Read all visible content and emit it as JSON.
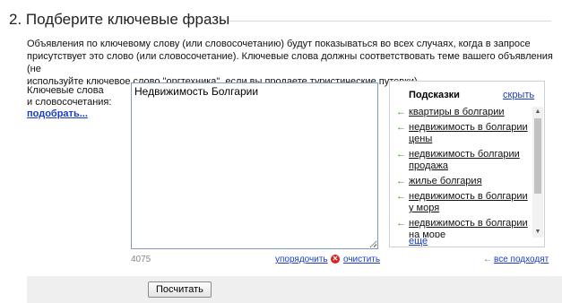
{
  "section": {
    "title": "2. Подберите ключевые фразы"
  },
  "description": {
    "line1": "Объявления по ключевому слову (или словосочетанию) будут показываться во всех случаях, когда в запросе",
    "line2": "присутствует это слово (или словосочетание). Ключевые слова должны соответствовать теме вашего объявления (не",
    "line3": "используйте ключевое слово \"оргтехника\", если вы продаете туристические путевки)."
  },
  "keywords": {
    "label_line1": "Ключевые слова",
    "label_line2": "и словосочетания:",
    "pick_link": "подобрать...",
    "value": "Недвижимость Болгарии",
    "char_count": "4075",
    "sort_link": "упорядочить",
    "clear_link": "очистить"
  },
  "hints": {
    "title": "Подсказки",
    "hide_link": "скрыть",
    "items": [
      {
        "line1": "квартиры в болгарии",
        "line2": ""
      },
      {
        "line1": "недвижимость в болгарии",
        "line2": "цены"
      },
      {
        "line1": "недвижимость болгарии",
        "line2": "продажа"
      },
      {
        "line1": "жилье болгария",
        "line2": ""
      },
      {
        "line1": "недвижимость в болгарии",
        "line2": "у моря"
      },
      {
        "line1": "недвижимость в болгарии",
        "line2": "на море"
      }
    ],
    "more_link": "еще",
    "all_fit_link": "все подходят"
  },
  "actions": {
    "calculate_label": "Посчитать"
  },
  "icons": {
    "add_arrow": "arrow-left-icon",
    "clear": "clear-x-icon"
  },
  "colors": {
    "link": "#1a3dc1",
    "arrow_green": "#3e9c22",
    "clear_red": "#d9231d",
    "bottom_bar": "#efefef"
  }
}
